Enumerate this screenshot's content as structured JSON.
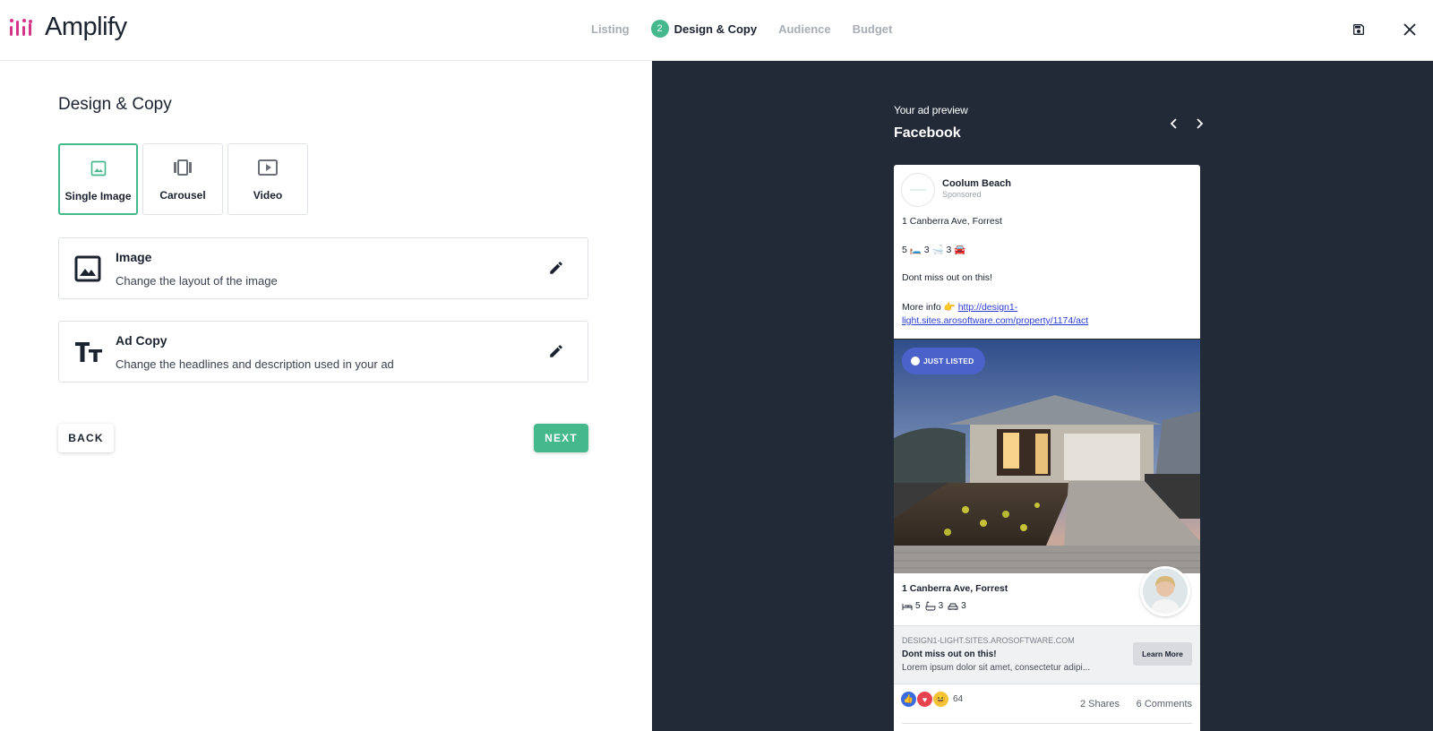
{
  "app": {
    "name": "Amplify"
  },
  "stepper": {
    "steps": [
      {
        "label": "Listing",
        "active": false
      },
      {
        "label": "Design & Copy",
        "active": true,
        "number": "2"
      },
      {
        "label": "Audience",
        "active": false
      },
      {
        "label": "Budget",
        "active": false
      }
    ]
  },
  "toolbar": {
    "save_icon": "save-icon",
    "close_icon": "close-icon"
  },
  "main": {
    "title": "Design & Copy",
    "formats": [
      {
        "label": "Single Image",
        "icon": "image-icon",
        "selected": true
      },
      {
        "label": "Carousel",
        "icon": "carousel-icon",
        "selected": false
      },
      {
        "label": "Video",
        "icon": "video-icon",
        "selected": false
      }
    ],
    "options": [
      {
        "title": "Image",
        "subtitle": "Change the layout of the image",
        "icon": "image-icon"
      },
      {
        "title": "Ad Copy",
        "subtitle": "Change the headlines and description used in your ad",
        "icon": "text-format-icon"
      }
    ],
    "back_label": "BACK",
    "next_label": "NEXT"
  },
  "preview": {
    "label": "Your ad preview",
    "platform": "Facebook",
    "post": {
      "page_name": "Coolum Beach",
      "sponsored": "Sponsored",
      "address_line": "1 Canberra Ave, Forrest",
      "features_line": "5 🛏️ 3 🛁 3 🚘",
      "cta_line": "Dont miss out on this!",
      "more_info": "More info 👉",
      "link_text_1": "http://design1-",
      "link_text_2": "light.sites.arosoftware.com/property/1174/act",
      "badge": "JUST LISTED",
      "listing_address": "1 Canberra Ave, Forrest",
      "beds": "5",
      "baths": "3",
      "cars": "3",
      "domain": "DESIGN1-LIGHT.SITES.AROSOFTWARE.COM",
      "headline": "Dont miss out on this!",
      "description": "Lorem ipsum dolor sit amet, consectetur adipi...",
      "learn_more": "Learn More",
      "reaction_count": "64",
      "shares": "2 Shares",
      "comments": "6 Comments"
    }
  },
  "colors": {
    "accent": "#46b98c",
    "brand": "#d6338a",
    "preview_bg": "#222a38",
    "badge": "#4a62c9"
  }
}
